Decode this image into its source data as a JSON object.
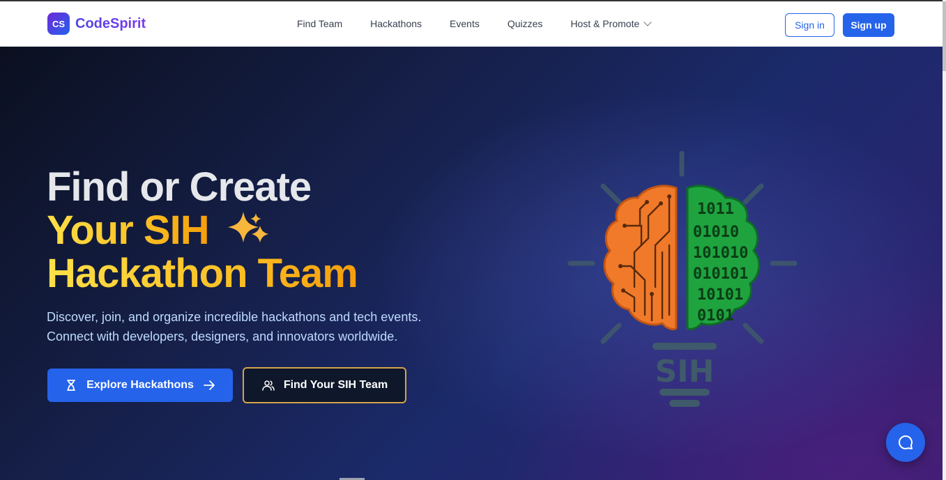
{
  "brand": {
    "badge": "CS",
    "name": "CodeSpirit"
  },
  "nav": {
    "items": [
      "Find Team",
      "Hackathons",
      "Events",
      "Quizzes",
      "Host & Promote"
    ],
    "signin": "Sign in",
    "signup": "Sign up"
  },
  "hero": {
    "line1": "Find or Create",
    "line2": "Your SIH",
    "line3": "Hackathon Team",
    "subtitle_1": "Discover, join, and organize incredible hackathons and tech events.",
    "subtitle_2": "Connect with developers, designers, and innovators worldwide.",
    "cta_primary": "Explore Hackathons",
    "cta_secondary": "Find Your SIH Team"
  },
  "illustration": {
    "label": "SIH",
    "binary_rows": [
      "1011",
      "01010",
      "101010",
      "010101",
      "10101",
      "0101"
    ]
  },
  "colors": {
    "accent": "#2563eb",
    "gold": "#fbbf24",
    "orange": "#f07a2a",
    "green": "#1fa33f"
  }
}
